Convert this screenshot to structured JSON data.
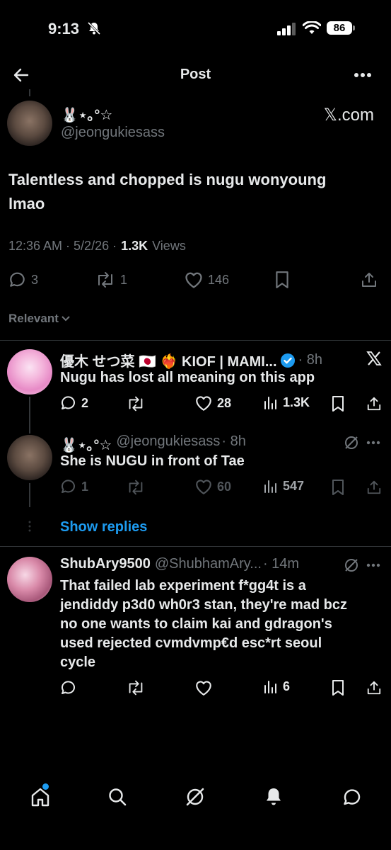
{
  "status": {
    "time": "9:13",
    "battery": "86"
  },
  "header": {
    "title": "Post"
  },
  "post": {
    "display_name": "🐰⋆｡°☆",
    "handle": "@jeongukiesass",
    "source": "𝕏.com",
    "text_line1": "Talentless and chopped is nugu wonyoung",
    "text_line2": "lmao",
    "time": "12:36 AM · 5/2/26 ·",
    "views_count": "1.3K",
    "views_label": "Views",
    "replies": "3",
    "reposts": "1",
    "likes": "146"
  },
  "sort": {
    "label": "Relevant"
  },
  "replies": [
    {
      "name": "優木 せつ菜 🇯🇵 ❤️‍🔥 KIOF | MAMI...",
      "time": "· 8h",
      "text": "Nugu has lost all meaning on this app",
      "replies": "2",
      "likes": "28",
      "views": "1.3K"
    },
    {
      "name": "🐰⋆｡°☆",
      "handle": "@jeongukiesass",
      "time": "· 8h",
      "text": "She is NUGU in front of Tae",
      "replies": "1",
      "likes": "60",
      "views": "547"
    },
    {
      "name": "ShubAry9500",
      "handle": "@ShubhamAry...",
      "time": "· 14m",
      "text_lines": [
        "That failed lab experiment f*gg4t is a",
        "jendiddy p3d0 wh0r3 stan, they're mad bcz",
        "no one wants to claim kai and gdragon's",
        "used rejected cvmdvmp€d esc*rt seoul",
        "cycle"
      ],
      "views": "6"
    }
  ],
  "show_replies": "Show replies",
  "colors": {
    "accent": "#1d9bf0",
    "verified": "#1d9bf0",
    "background": "#000000",
    "divider": "#2f3336"
  }
}
